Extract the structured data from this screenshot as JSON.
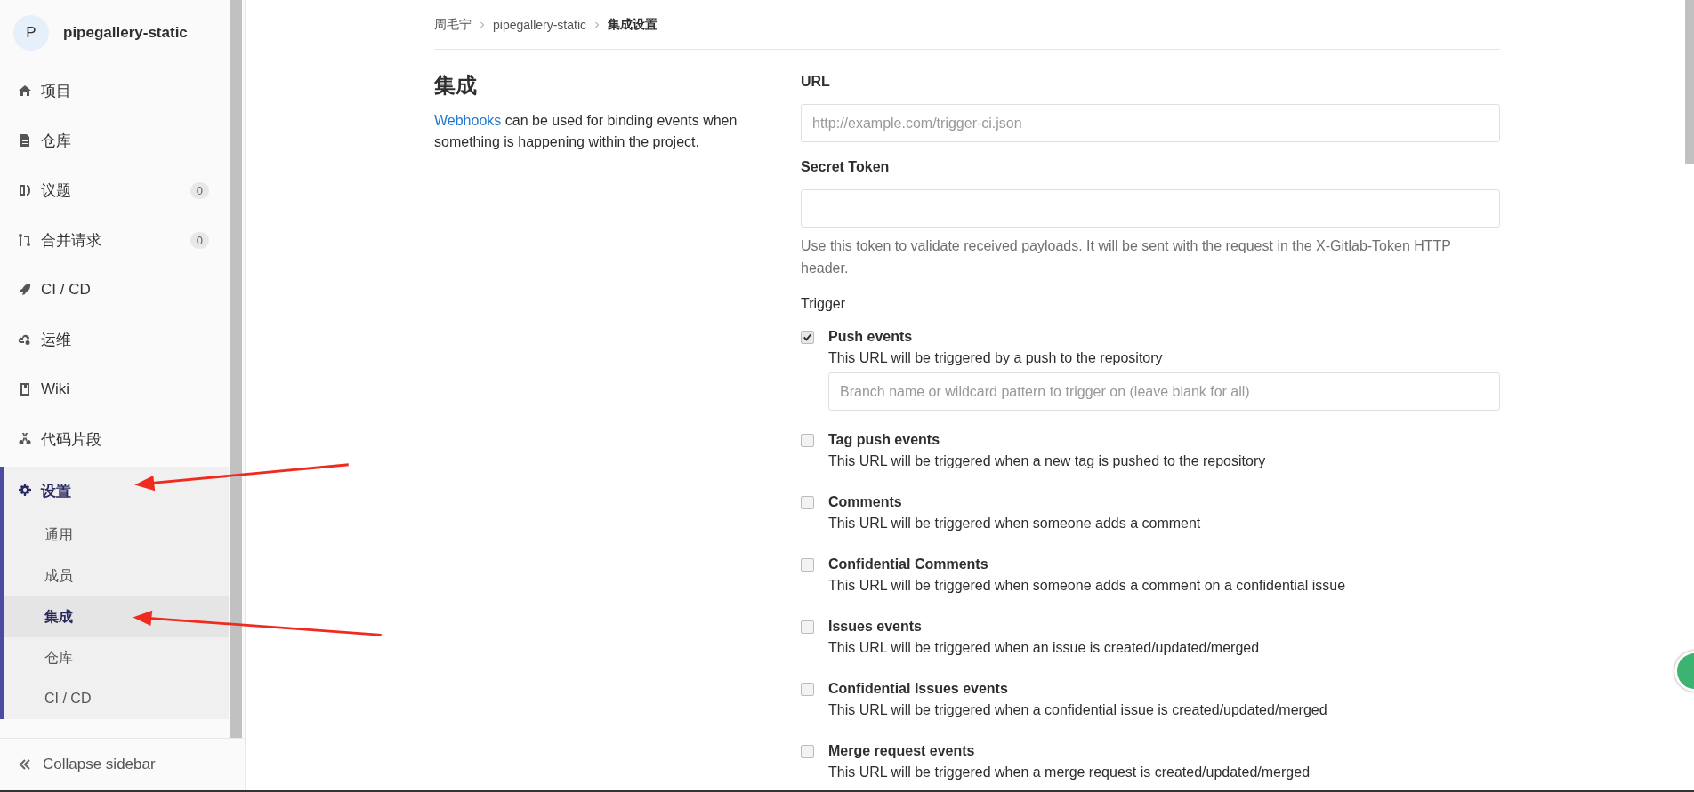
{
  "sidebar": {
    "project": {
      "avatar": "P",
      "name": "pipegallery-static"
    },
    "items": [
      {
        "label": "项目",
        "selected": false
      },
      {
        "label": "仓库",
        "selected": false
      },
      {
        "label": "议题",
        "badge": "0",
        "selected": false
      },
      {
        "label": "合并请求",
        "badge": "0",
        "selected": false
      },
      {
        "label": "CI / CD",
        "selected": false
      },
      {
        "label": "运维",
        "selected": false
      },
      {
        "label": "Wiki",
        "selected": false
      },
      {
        "label": "代码片段",
        "selected": false
      },
      {
        "label": "设置",
        "selected": true,
        "expanded": true,
        "children": [
          {
            "label": "通用",
            "selected": false
          },
          {
            "label": "成员",
            "selected": false
          },
          {
            "label": "集成",
            "selected": true
          },
          {
            "label": "仓库",
            "selected": false
          },
          {
            "label": "CI / CD",
            "selected": false
          }
        ]
      }
    ],
    "collapse": "Collapse sidebar"
  },
  "breadcrumb": [
    "周毛宁",
    "pipegallery-static",
    "集成设置"
  ],
  "section": {
    "title": "集成",
    "link": "Webhooks",
    "description": " can be used for binding events when something is happening within the project."
  },
  "form": {
    "url": {
      "label": "URL",
      "placeholder": "http://example.com/trigger-ci.json"
    },
    "secret_token": {
      "label": "Secret Token",
      "help": "Use this token to validate received payloads. It will be sent with the request in the X-Gitlab-Token HTTP header."
    },
    "trigger_label": "Trigger",
    "triggers": [
      {
        "label": "Push events",
        "description": "This URL will be triggered by a push to the repository",
        "checked": true,
        "branch_placeholder": "Branch name or wildcard pattern to trigger on (leave blank for all)"
      },
      {
        "label": "Tag push events",
        "description": "This URL will be triggered when a new tag is pushed to the repository",
        "checked": false
      },
      {
        "label": "Comments",
        "description": "This URL will be triggered when someone adds a comment",
        "checked": false
      },
      {
        "label": "Confidential Comments",
        "description": "This URL will be triggered when someone adds a comment on a confidential issue",
        "checked": false
      },
      {
        "label": "Issues events",
        "description": "This URL will be triggered when an issue is created/updated/merged",
        "checked": false
      },
      {
        "label": "Confidential Issues events",
        "description": "This URL will be triggered when a confidential issue is created/updated/merged",
        "checked": false
      },
      {
        "label": "Merge request events",
        "description": "This URL will be triggered when a merge request is created/updated/merged",
        "checked": false
      }
    ]
  }
}
